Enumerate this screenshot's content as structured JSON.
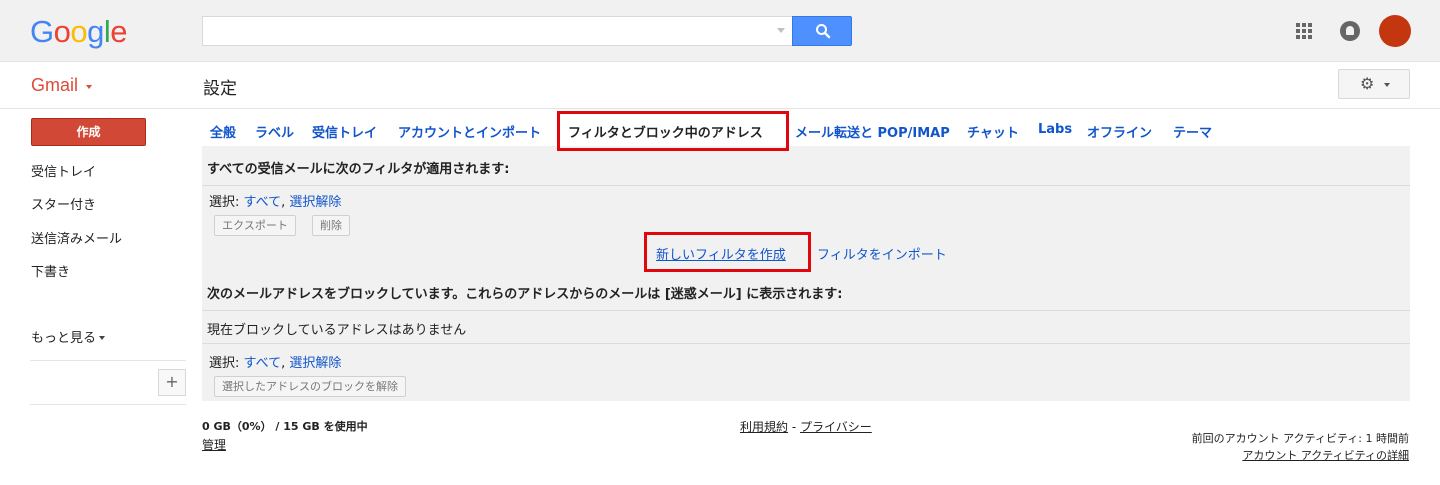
{
  "header": {
    "logo_letters": [
      "G",
      "o",
      "o",
      "g",
      "l",
      "e"
    ],
    "logo_colors": [
      "#4285f4",
      "#ea4335",
      "#fbbc05",
      "#4285f4",
      "#34a853",
      "#ea4335"
    ],
    "search": {
      "value": "",
      "placeholder": ""
    },
    "icons": [
      "search-icon",
      "apps-grid-icon",
      "notifications-icon",
      "avatar"
    ],
    "avatar_color": "#c4360f"
  },
  "subheader": {
    "app_label": "Gmail",
    "page_title": "設定",
    "settings_icon": "gear-icon"
  },
  "sidebar": {
    "compose_label": "作成",
    "items": [
      {
        "label": "受信トレイ"
      },
      {
        "label": "スター付き"
      },
      {
        "label": "送信済みメール"
      },
      {
        "label": "下書き"
      }
    ],
    "more_label": "もっと見る",
    "add_label": "+"
  },
  "tabs": [
    {
      "label": "全般"
    },
    {
      "label": "ラベル"
    },
    {
      "label": "受信トレイ"
    },
    {
      "label": "アカウントとインポート"
    },
    {
      "label": "フィルタとブロック中のアドレス",
      "active": true
    },
    {
      "label": "メール転送と POP/IMAP"
    },
    {
      "label": "チャット"
    },
    {
      "label": "Labs"
    },
    {
      "label": "オフライン"
    },
    {
      "label": "テーマ"
    }
  ],
  "filters_section": {
    "title": "すべての受信メールに次のフィルタが適用されます:",
    "select_prefix": "選択:",
    "select_all": "すべて",
    "select_none": "選択解除",
    "export_button": "エクスポート",
    "delete_button": "削除",
    "create_filter_link": "新しいフィルタを作成",
    "import_filter_link": "フィルタをインポート"
  },
  "blocked_section": {
    "title": "次のメールアドレスをブロックしています。これらのアドレスからのメールは [迷惑メール] に表示されます:",
    "empty_message": "現在ブロックしているアドレスはありません",
    "select_prefix": "選択:",
    "select_all": "すべて",
    "select_none": "選択解除",
    "unblock_button": "選択したアドレスのブロックを解除"
  },
  "footer": {
    "storage": "0 GB（0%） / 15 GB を使用中",
    "manage_link": "管理",
    "terms_link": "利用規約",
    "separator": "-",
    "privacy_link": "プライバシー",
    "last_activity": "前回のアカウント アクティビティ: 1 時間前",
    "activity_details_link": "アカウント アクティビティの詳細"
  },
  "colors": {
    "link": "#1155cc",
    "highlight_box": "#e0060e",
    "compose_button": "#d14836",
    "search_button": "#4d90fe"
  }
}
